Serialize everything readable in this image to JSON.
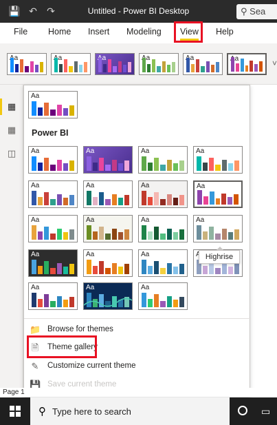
{
  "titlebar": {
    "title": "Untitled - Power BI Desktop",
    "search_text": "Sea",
    "icons": [
      "save-icon",
      "undo-icon",
      "redo-icon",
      "search-icon"
    ]
  },
  "ribbon_tabs": [
    "File",
    "Home",
    "Insert",
    "Modeling",
    "View",
    "Help"
  ],
  "active_tab": "View",
  "colors": {
    "accent_yellow": "#f2c811",
    "highlight_red": "#e81123"
  },
  "themes_menu": {
    "current_label": "Aa",
    "section_label": "Power BI",
    "tooltip": "Highrise",
    "menu_items": [
      {
        "label": "Browse for themes",
        "icon": "folder-icon",
        "enabled": true
      },
      {
        "label": "Theme gallery",
        "icon": "gallery-icon",
        "enabled": true
      },
      {
        "label": "Customize current theme",
        "icon": "paint-icon",
        "enabled": true
      },
      {
        "label": "Save current theme",
        "icon": "save-icon",
        "enabled": false
      }
    ]
  },
  "status_bar": {
    "page_text": "Page 1"
  },
  "taskbar": {
    "search_placeholder": "Type here to search"
  }
}
